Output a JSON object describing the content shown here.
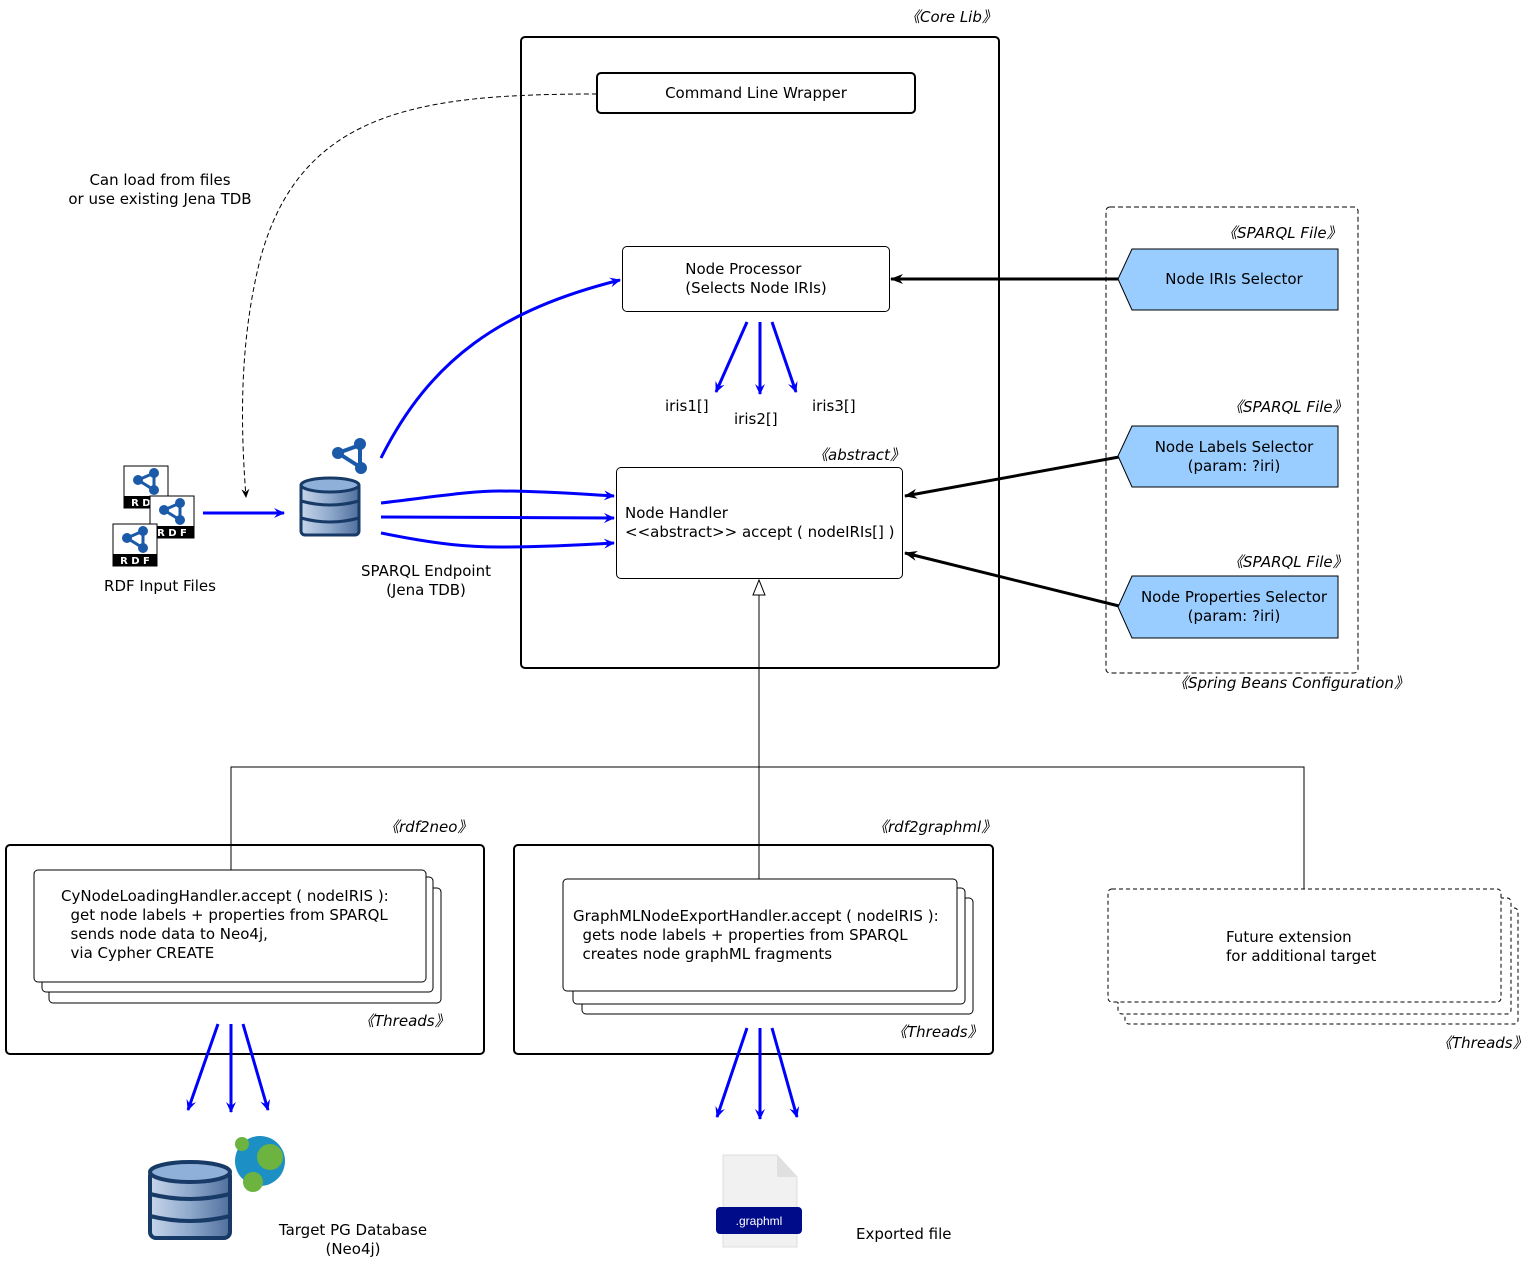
{
  "stereotypes": {
    "core_lib": "《Core Lib》",
    "abstract": "《abstract》",
    "sparql_file": "《SPARQL File》",
    "spring_beans": "《Spring Beans Configuration》",
    "rdf2neo": "《rdf2neo》",
    "rdf2graphml": "《rdf2graphml》",
    "threads": "《Threads》"
  },
  "core": {
    "command_line_wrapper": "Command Line Wrapper",
    "node_processor": "Node Processor\n(Selects Node IRIs)",
    "iris": [
      "iris1[]",
      "iris2[]",
      "iris3[]"
    ],
    "node_handler": "Node Handler\n<<abstract>> accept ( nodeIRIs[] )"
  },
  "inputs": {
    "annotation": "Can load from files\nor use existing Jena TDB",
    "rdf_files_label": "RDF Input Files",
    "rdf_badge": "R D F",
    "sparql_endpoint_label": "SPARQL Endpoint\n(Jena TDB)"
  },
  "spring": {
    "selectors": [
      {
        "label": "Node IRIs Selector"
      },
      {
        "label": "Node Labels Selector\n(param: ?iri)"
      },
      {
        "label": "Node Properties Selector\n(param: ?iri)"
      }
    ],
    "selector_color": "#99ccff"
  },
  "handlers": {
    "neo": "CyNodeLoadingHandler.accept ( nodeIRIS ):\n  get node labels + properties from SPARQL\n  sends node data to Neo4j,\n  via Cypher CREATE",
    "graphml": "GraphMLNodeExportHandler.accept ( nodeIRIS ):\n  gets node labels + properties from SPARQL\n  creates node graphML fragments",
    "future": "Future extension\nfor additional target"
  },
  "outputs": {
    "neo4j_label": "Target PG Database\n(Neo4j)",
    "graphml_file_ext": ".graphml",
    "exported_label": "Exported file"
  },
  "colors": {
    "flow_arrow": "#0000ff",
    "db_dark": "#173a66",
    "db_light": "#8fb0d8",
    "neo4j_blue": "#1c8fc4",
    "neo4j_green": "#6db33f",
    "graphml_badge": "#000b8a"
  }
}
